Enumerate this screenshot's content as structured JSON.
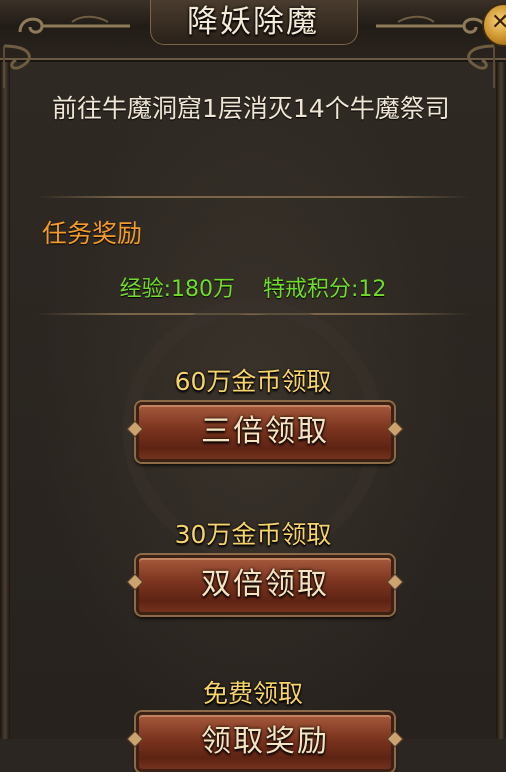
{
  "window": {
    "title": "降妖除魔"
  },
  "task": {
    "description": "前往牛魔洞窟1层消灭14个牛魔祭司"
  },
  "rewards": {
    "heading": "任务奖励",
    "exp": "经验:180万",
    "points": "特戒积分:12"
  },
  "options": [
    {
      "label": "60万金币领取",
      "button": "三倍领取"
    },
    {
      "label": "30万金币领取",
      "button": "双倍领取"
    },
    {
      "label": "免费领取",
      "button": "领取奖励"
    }
  ],
  "colors": {
    "title_text": "#f3ead8",
    "reward_heading": "#f29b2c",
    "reward_value": "#6fdc2a",
    "option_label": "#f7d36b",
    "button_face": "#7a331e"
  },
  "icons": {
    "close": "close-icon"
  }
}
